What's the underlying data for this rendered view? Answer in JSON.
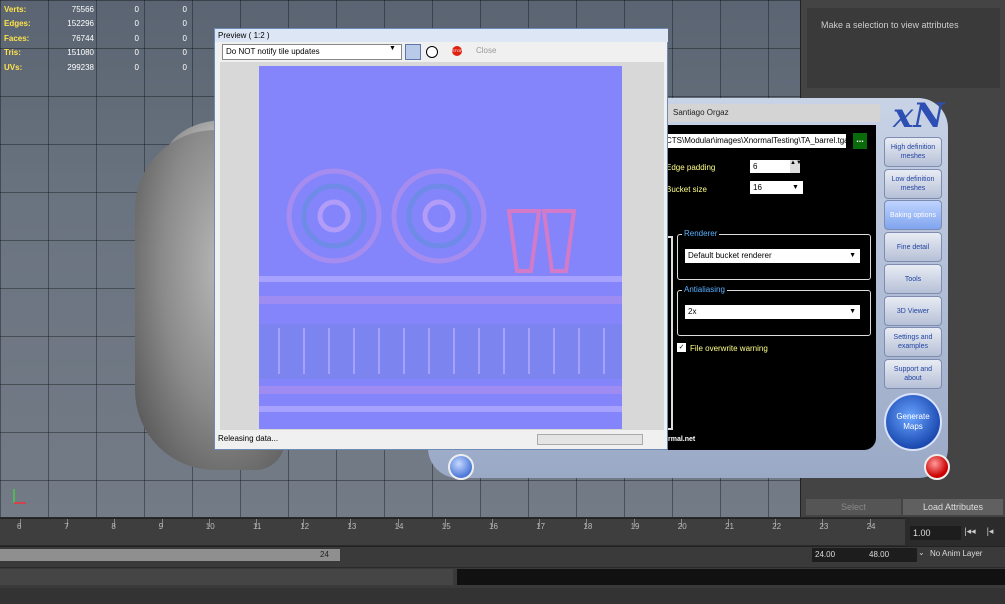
{
  "stats": [
    {
      "label": "Verts:",
      "v1": "75566",
      "v2": "0",
      "v3": "0"
    },
    {
      "label": "Edges:",
      "v1": "152296",
      "v2": "0",
      "v3": "0"
    },
    {
      "label": "Faces:",
      "v1": "76744",
      "v2": "0",
      "v3": "0"
    },
    {
      "label": "Tris:",
      "v1": "151080",
      "v2": "0",
      "v3": "0"
    },
    {
      "label": "UVs:",
      "v1": "299238",
      "v2": "0",
      "v3": "0"
    }
  ],
  "attributes": {
    "hint": "Make a selection to view attributes",
    "select_label": "Select",
    "load_label": "Load Attributes"
  },
  "timeline": {
    "ticks": [
      "6",
      "7",
      "8",
      "9",
      "10",
      "11",
      "12",
      "13",
      "14",
      "15",
      "16",
      "17",
      "18",
      "19",
      "20",
      "21",
      "22",
      "23",
      "24"
    ],
    "current_frame": "1.00",
    "range_end_marker": "24",
    "range_start": "24.00",
    "range_max": "48.00",
    "anim_layer": "No Anim Layer"
  },
  "xnormal": {
    "title": "Santiago Orgaz",
    "logo": "xN",
    "path": "CTS\\Modular\\images\\XnormalTesting\\TA_barrel.tga",
    "path_btn": "...",
    "edge_padding_label": "Edge padding",
    "edge_padding_value": "6",
    "bucket_size_label": "Bucket size",
    "bucket_size_value": "16",
    "renderer_title": "Renderer",
    "renderer_value": "Default bucket renderer",
    "aa_title": "Antialiasing",
    "aa_value": "2x",
    "overwrite_label": "File overwrite warning",
    "link": "rmal.net",
    "side_buttons": [
      "High definition meshes",
      "Low definition meshes",
      "Baking options",
      "Fine detail",
      "Tools",
      "3D Viewer",
      "Settings and examples",
      "Support and about"
    ],
    "generate_label": "Generate Maps"
  },
  "preview": {
    "title": "Preview ( 1:2 )",
    "select_value": "Do NOT notify tile updates",
    "close_label": "Close",
    "stop_label": "STOP",
    "status": "Releasing data..."
  },
  "colors": {
    "normal_map_base": "#8080ff",
    "xn_frame": "#b4c1da",
    "accent_blue": "#2344a3"
  }
}
